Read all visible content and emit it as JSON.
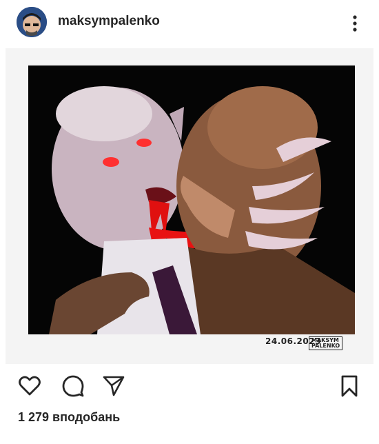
{
  "post": {
    "username": "maksympalenko",
    "likes_text": "1 279 вподобань",
    "image_signature_date": "24.06.2023",
    "image_stamp_line1": "MAKSYM",
    "image_stamp_line2": "PALENKO"
  },
  "icons": {
    "more": "more-vertical-icon",
    "like": "heart-icon",
    "comment": "comment-icon",
    "share": "send-icon",
    "save": "bookmark-icon"
  },
  "colors": {
    "text": "#262626",
    "background": "#ffffff"
  }
}
